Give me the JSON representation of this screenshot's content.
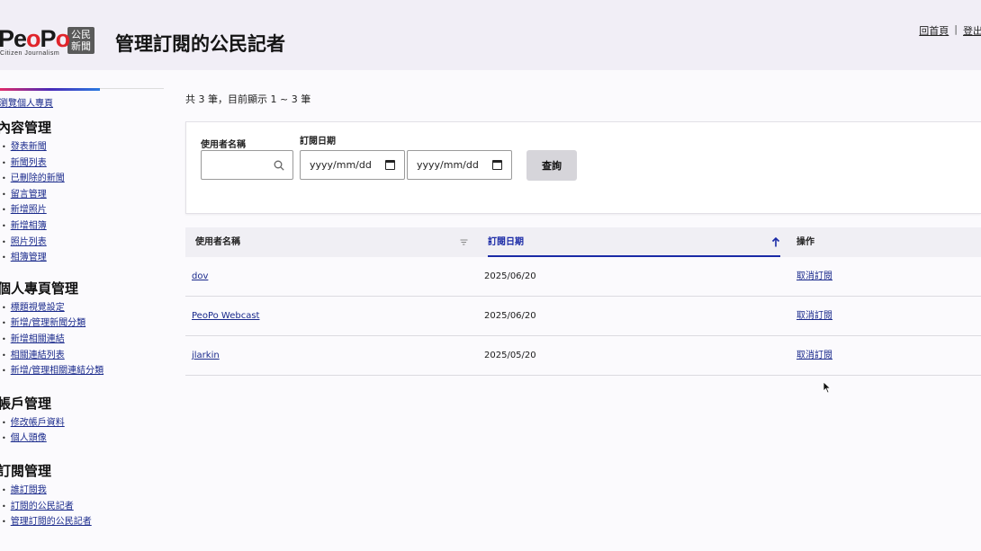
{
  "header": {
    "logo_text": "PeoPo",
    "logo_sub": "Citizen Journalism",
    "logo_badge_line1": "公民",
    "logo_badge_line2": "新聞",
    "page_title": "管理訂閱的公民記者",
    "home_link": "回首頁",
    "separator": "|",
    "logout_link": "登出"
  },
  "sidebar": {
    "profile_link": "瀏覽個人專頁",
    "sections": [
      {
        "title": "內容管理",
        "items": [
          "發表新聞",
          "新聞列表",
          "已刪除的新聞",
          "留言管理",
          "新增照片",
          "新增相簿",
          "照片列表",
          "相簿管理"
        ]
      },
      {
        "title": "個人專頁管理",
        "items": [
          "標題視覺設定",
          "新增/管理新聞分類",
          "新增相關連結",
          "相關連結列表",
          "新增/管理相關連結分類"
        ]
      },
      {
        "title": "帳戶管理",
        "items": [
          "修改帳戶資料",
          "個人頭像"
        ]
      },
      {
        "title": "訂閱管理",
        "items": [
          "誰訂閱我",
          "訂閱的公民記者",
          "管理訂閱的公民記者"
        ]
      }
    ]
  },
  "main": {
    "count_text": "共 3 筆，目前顯示 1 ~ 3 筆",
    "filter": {
      "username_label": "使用者名稱",
      "date_label": "訂閱日期",
      "date_from_placeholder": "yyyy/mm/dd",
      "date_to_placeholder": "yyyy/mm/dd",
      "search_button": "查詢"
    },
    "table": {
      "columns": [
        "使用者名稱",
        "訂閱日期",
        "操作"
      ],
      "rows": [
        {
          "user": "dov",
          "date": "2025/06/20",
          "action": "取消訂閱"
        },
        {
          "user": "PeoPo Webcast",
          "date": "2025/06/20",
          "action": "取消訂閱"
        },
        {
          "user": "jlarkin",
          "date": "2025/05/20",
          "action": "取消訂閱"
        }
      ]
    }
  },
  "colors": {
    "header_bg": "#f1eef6",
    "link": "#1a2a8c",
    "active_sort": "#1a2aa6",
    "logo_red": "#e0242b"
  },
  "icons": {
    "search": "search-icon",
    "calendar": "calendar-icon",
    "sort_neutral": "sort-icon",
    "sort_ascending": "arrow-up-icon"
  }
}
